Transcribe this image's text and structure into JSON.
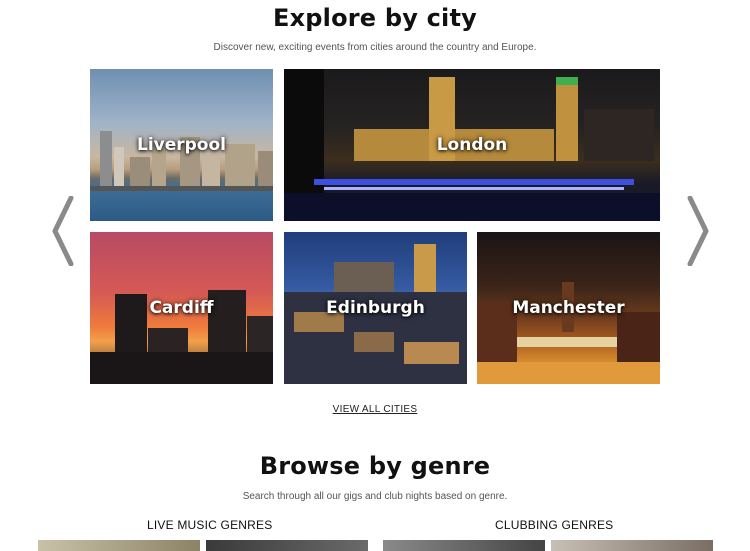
{
  "explore": {
    "title": "Explore by city",
    "subtitle": "Discover new, exciting events from cities around the country and Europe.",
    "prev_icon": "chevron-left-icon",
    "next_icon": "chevron-right-icon",
    "cities": [
      {
        "name": "Liverpool"
      },
      {
        "name": "London"
      },
      {
        "name": "Cardiff"
      },
      {
        "name": "Edinburgh"
      },
      {
        "name": "Manchester"
      }
    ],
    "view_all_label": "VIEW ALL CITIES"
  },
  "genre": {
    "title": "Browse by genre",
    "subtitle": "Search through all our gigs and club nights based on genre.",
    "live_heading": "LIVE MUSIC GENRES",
    "clubbing_heading": "CLUBBING GENRES"
  }
}
